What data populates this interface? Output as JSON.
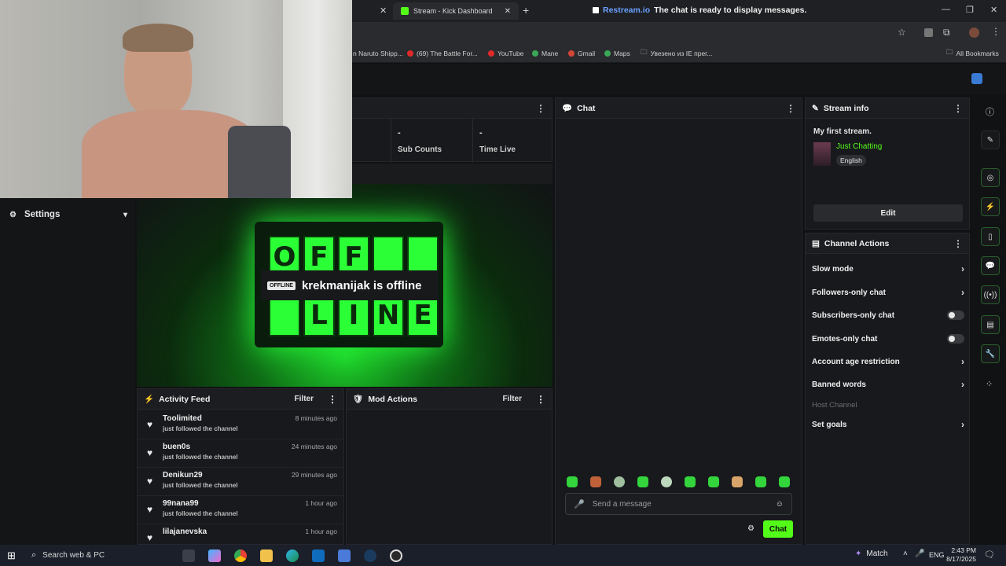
{
  "browser": {
    "tabs": [
      {
        "label": "Stream - Kick Dashboard"
      }
    ],
    "restream_notice": {
      "brand": "Restream.io",
      "message": "The chat is ready to display messages."
    },
    "bookmarks": [
      "n Naruto Shipp...",
      "(69) The Battle For...",
      "YouTube",
      "Mane",
      "Gmail",
      "Maps",
      "Увезено из IE прег..."
    ],
    "all_bookmarks": "All Bookmarks"
  },
  "sidebar": {
    "settings_label": "Settings"
  },
  "stats": [
    {
      "value": "-",
      "label": "Sub Counts"
    },
    {
      "value": "-",
      "label": "Time Live"
    }
  ],
  "video": {
    "badge": "OFFLINE",
    "status": "krekmanijak is offline",
    "sign_top": [
      "O",
      "F",
      "F",
      "",
      ""
    ],
    "sign_bottom": [
      "L",
      "I",
      "N",
      "E"
    ]
  },
  "activity_feed": {
    "title": "Activity Feed",
    "filter": "Filter",
    "items": [
      {
        "name": "Toolimited",
        "action": "just followed the channel",
        "time": "8 minutes ago"
      },
      {
        "name": "buen0s",
        "action": "just followed the channel",
        "time": "24 minutes ago"
      },
      {
        "name": "Denikun29",
        "action": "just followed the channel",
        "time": "29 minutes ago"
      },
      {
        "name": "99nana99",
        "action": "just followed the channel",
        "time": "1 hour ago"
      },
      {
        "name": "lilajanevska",
        "action": "",
        "time": "1 hour ago"
      }
    ]
  },
  "mod_actions": {
    "title": "Mod Actions",
    "filter": "Filter"
  },
  "chat": {
    "title": "Chat",
    "placeholder": "Send a message",
    "send_label": "Chat"
  },
  "stream_info": {
    "title": "Stream info",
    "stream_title": "My first stream.",
    "category": "Just Chatting",
    "language": "English",
    "edit_label": "Edit"
  },
  "channel_actions": {
    "title": "Channel Actions",
    "items": [
      {
        "label": "Slow mode",
        "control": "chevron"
      },
      {
        "label": "Followers-only chat",
        "control": "chevron"
      },
      {
        "label": "Subscribers-only chat",
        "control": "toggle"
      },
      {
        "label": "Emotes-only chat",
        "control": "toggle"
      },
      {
        "label": "Account age restriction",
        "control": "chevron"
      },
      {
        "label": "Banned words",
        "control": "chevron"
      },
      {
        "label": "Host Channel",
        "control": "disabled"
      },
      {
        "label": "Set goals",
        "control": "chevron"
      }
    ]
  },
  "taskbar": {
    "search_placeholder": "Search web & PC",
    "weather_app": "Match",
    "language": "ENG",
    "time": "2:43 PM",
    "date": "8/17/2025"
  },
  "colors": {
    "accent": "#53fc18",
    "panel": "#18191c",
    "background": "#111214"
  }
}
